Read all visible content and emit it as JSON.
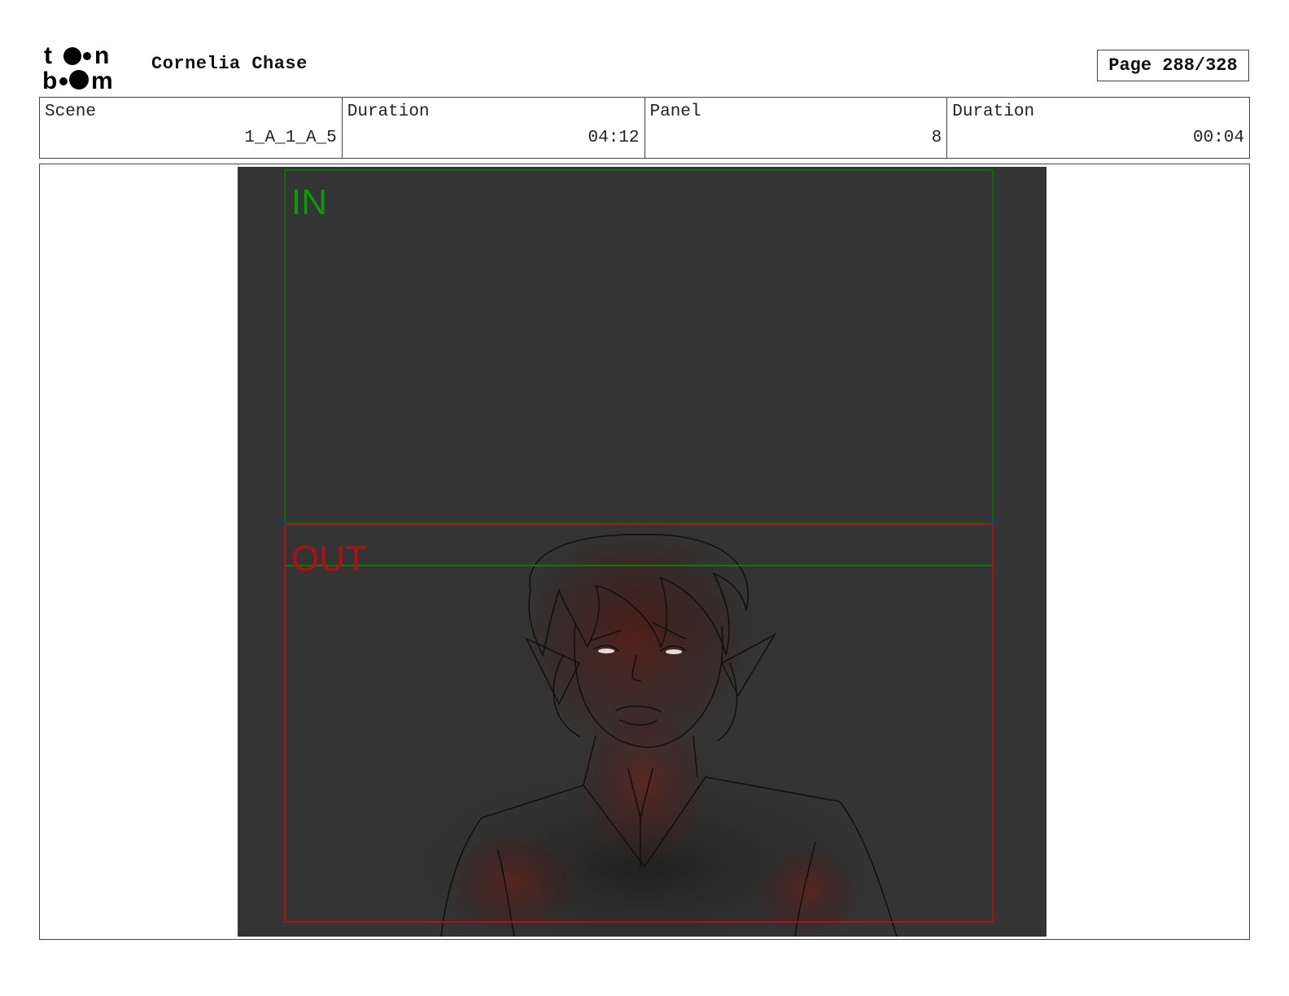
{
  "header": {
    "logo_text": "toon boom",
    "project_title": "Cornelia Chase",
    "page_label": "Page 288/328"
  },
  "info": {
    "scene_label": "Scene",
    "scene_value": "1_A_1_A_5",
    "scene_duration_label": "Duration",
    "scene_duration_value": "04:12",
    "panel_label": "Panel",
    "panel_value": "8",
    "panel_duration_label": "Duration",
    "panel_duration_value": "00:04"
  },
  "panel": {
    "in_label": "IN",
    "out_label": "OUT",
    "colors": {
      "background": "#343434",
      "in_frame": "#0a7a0a",
      "out_frame": "#b01010",
      "glow": "#7a1e12"
    }
  }
}
